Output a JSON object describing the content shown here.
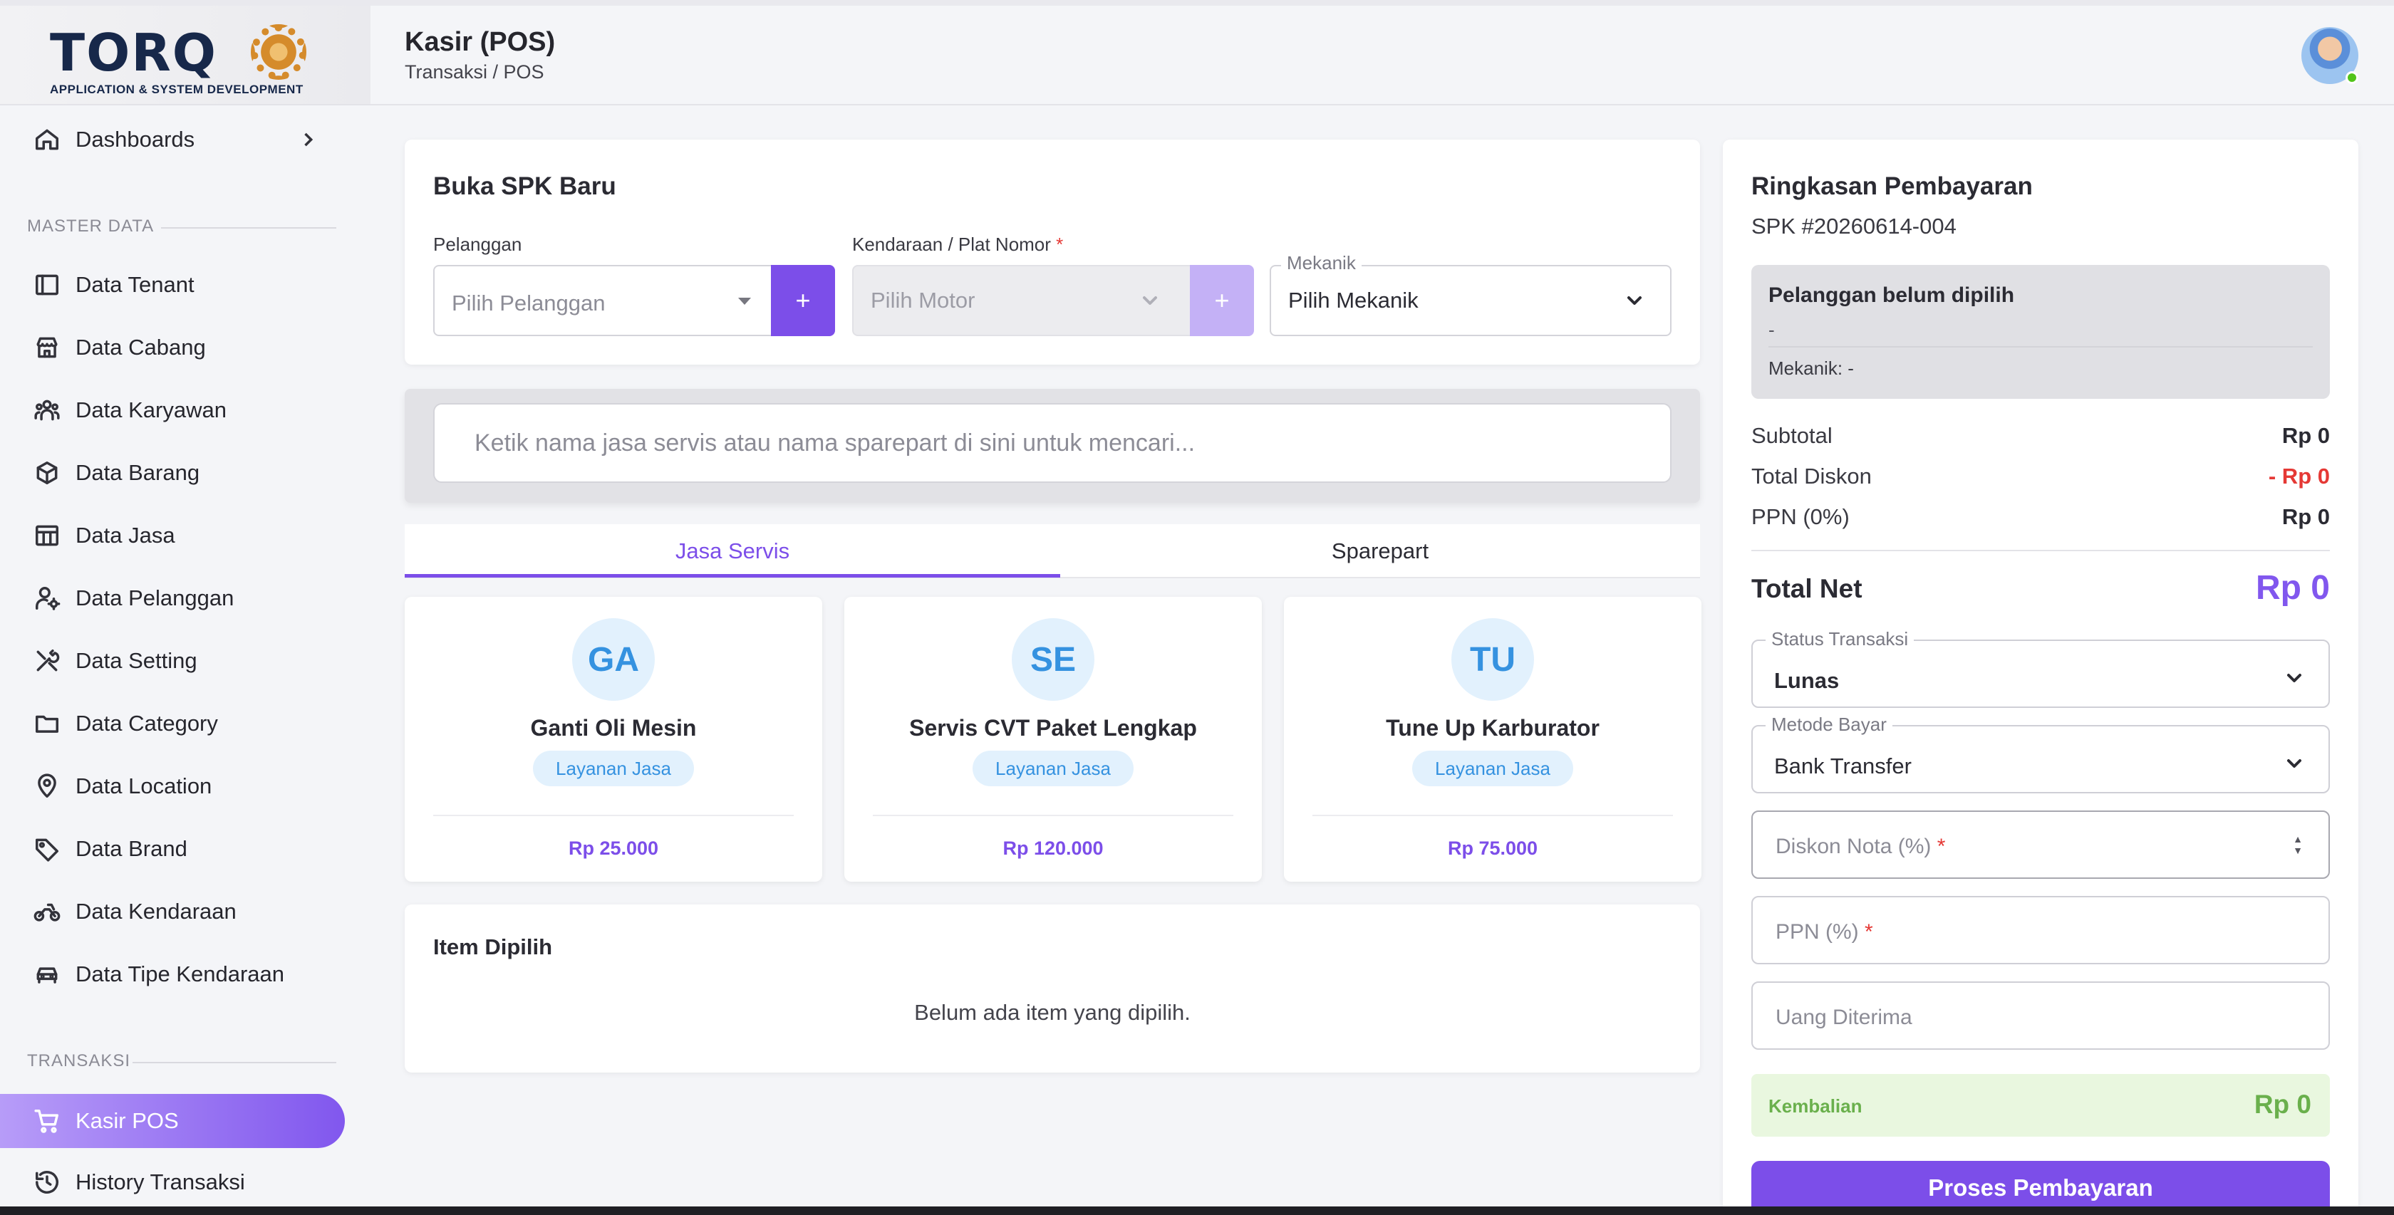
{
  "brand": {
    "logo_text": "TORQ",
    "logo_subtitle": "APPLICATION & SYSTEM DEVELOPMENT"
  },
  "header": {
    "title": "Kasir (POS)",
    "breadcrumb": "Transaksi / POS"
  },
  "sidebar": {
    "dashboards": "Dashboards",
    "master_heading": "MASTER DATA",
    "master_items": [
      {
        "label": "Data Tenant",
        "icon": "layout-icon"
      },
      {
        "label": "Data Cabang",
        "icon": "store-icon"
      },
      {
        "label": "Data Karyawan",
        "icon": "users-icon"
      },
      {
        "label": "Data Barang",
        "icon": "box-icon"
      },
      {
        "label": "Data Jasa",
        "icon": "columns-icon"
      },
      {
        "label": "Data Pelanggan",
        "icon": "user-gear-icon"
      },
      {
        "label": "Data Setting",
        "icon": "tools-icon"
      },
      {
        "label": "Data Category",
        "icon": "folder-icon"
      },
      {
        "label": "Data Location",
        "icon": "location-pin-icon"
      },
      {
        "label": "Data Brand",
        "icon": "tag-icon"
      },
      {
        "label": "Data Kendaraan",
        "icon": "motorcycle-icon"
      },
      {
        "label": "Data Tipe Kendaraan",
        "icon": "car-icon"
      }
    ],
    "transaksi_heading": "TRANSAKSI",
    "transaksi_items": [
      {
        "label": "Kasir POS",
        "icon": "cart-icon",
        "active": true
      },
      {
        "label": "History Transaksi",
        "icon": "history-icon",
        "active": false
      }
    ]
  },
  "spk": {
    "title": "Buka SPK Baru",
    "pelanggan_label": "Pelanggan",
    "pelanggan_placeholder": "Pilih Pelanggan",
    "kendaraan_label": "Kendaraan / Plat Nomor",
    "required_mark": "*",
    "kendaraan_placeholder": "Pilih Motor",
    "mekanik_label": "Mekanik",
    "mekanik_value": "Pilih Mekanik",
    "plus": "+"
  },
  "search": {
    "placeholder": "Ketik nama jasa servis atau nama sparepart di sini untuk mencari..."
  },
  "tabs": [
    {
      "label": "Jasa Servis",
      "active": true
    },
    {
      "label": "Sparepart",
      "active": false
    }
  ],
  "products": [
    {
      "initials": "GA",
      "name": "Ganti Oli Mesin",
      "badge": "Layanan Jasa",
      "price": "Rp 25.000"
    },
    {
      "initials": "SE",
      "name": "Servis CVT Paket Lengkap",
      "badge": "Layanan Jasa",
      "price": "Rp 120.000"
    },
    {
      "initials": "TU",
      "name": "Tune Up Karburator",
      "badge": "Layanan Jasa",
      "price": "Rp 75.000"
    }
  ],
  "selected": {
    "title": "Item Dipilih",
    "empty": "Belum ada item yang dipilih."
  },
  "summary": {
    "title": "Ringkasan Pembayaran",
    "spk_number": "SPK #20260614-004",
    "customer_title": "Pelanggan belum dipilih",
    "customer_sub": "-",
    "mekanik_line": "Mekanik: -",
    "subtotal_label": "Subtotal",
    "subtotal_value": "Rp 0",
    "diskon_label": "Total Diskon",
    "diskon_value": "- Rp 0",
    "ppn_label": "PPN (0%)",
    "ppn_value": "Rp 0",
    "total_label": "Total Net",
    "total_value": "Rp 0",
    "status_label": "Status Transaksi",
    "status_value": "Lunas",
    "metode_label": "Metode Bayar",
    "metode_value": "Bank Transfer",
    "diskon_nota_placeholder": "Diskon Nota (%)",
    "ppn_placeholder": "PPN (%)",
    "uang_placeholder": "Uang Diterima",
    "kembalian_label": "Kembalian",
    "kembalian_value": "Rp 0",
    "button": "Proses Pembayaran"
  },
  "colors": {
    "accent": "#7c4ee9",
    "accent_light": "#b79cf8",
    "danger": "#e53935",
    "success": "#6ab04c",
    "info": "#3592e0"
  }
}
